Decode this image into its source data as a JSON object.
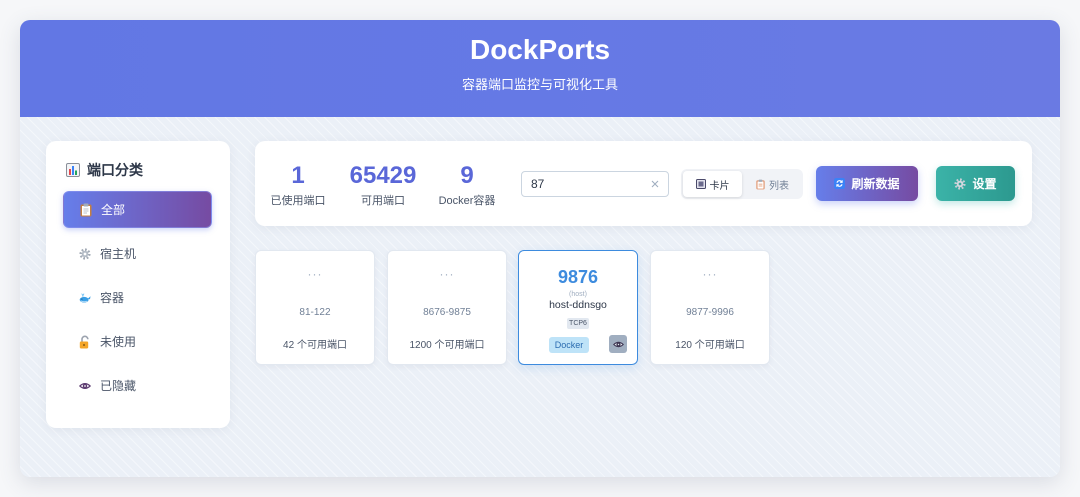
{
  "app": {
    "title": "DockPorts",
    "subtitle": "容器端口监控与可视化工具"
  },
  "colors": {
    "header": "#6579e5",
    "accent_start": "#667eea",
    "accent_end": "#764ba2",
    "stat_number": "#5a67d8",
    "settings_start": "#3bb3a8",
    "settings_end": "#2c998f",
    "port_highlight": "#3d8bde",
    "docker_badge_bg": "#bee3f8",
    "docker_badge_text": "#2b6cb0"
  },
  "sidebar": {
    "title": "端口分类",
    "title_icon": "bar-chart-icon",
    "items": [
      {
        "label": "全部",
        "icon": "clipboard-icon",
        "active": true
      },
      {
        "label": "宿主机",
        "icon": "gear-icon",
        "active": false
      },
      {
        "label": "容器",
        "icon": "whale-icon",
        "active": false
      },
      {
        "label": "未使用",
        "icon": "unlock-icon",
        "active": false
      },
      {
        "label": "已隐藏",
        "icon": "eye-icon",
        "active": false
      }
    ]
  },
  "stats": [
    {
      "value": "1",
      "label": "已使用端口"
    },
    {
      "value": "65429",
      "label": "可用端口"
    },
    {
      "value": "9",
      "label": "Docker容器"
    }
  ],
  "search": {
    "value": "87",
    "clear_icon": "clear-icon"
  },
  "view_toggle": {
    "options": [
      {
        "label": "卡片",
        "icon": "card-view-icon",
        "active": true
      },
      {
        "label": "列表",
        "icon": "list-view-icon",
        "active": false
      }
    ]
  },
  "actions": {
    "refresh": {
      "label": "刷新数据",
      "icon": "refresh-icon"
    },
    "settings": {
      "label": "设置",
      "icon": "gear-icon"
    }
  },
  "port_cards": [
    {
      "dots": "···",
      "range": "81-122",
      "available": "42 个可用端口"
    },
    {
      "dots": "···",
      "range": "8676-9875",
      "available": "1200 个可用端口"
    },
    {
      "port": "9876",
      "source": "(host)",
      "service": "host-ddnsgo",
      "protocol": "TCP6",
      "tag": "Docker",
      "action_icon": "eye-icon"
    },
    {
      "dots": "···",
      "range": "9877-9996",
      "available": "120 个可用端口"
    }
  ]
}
